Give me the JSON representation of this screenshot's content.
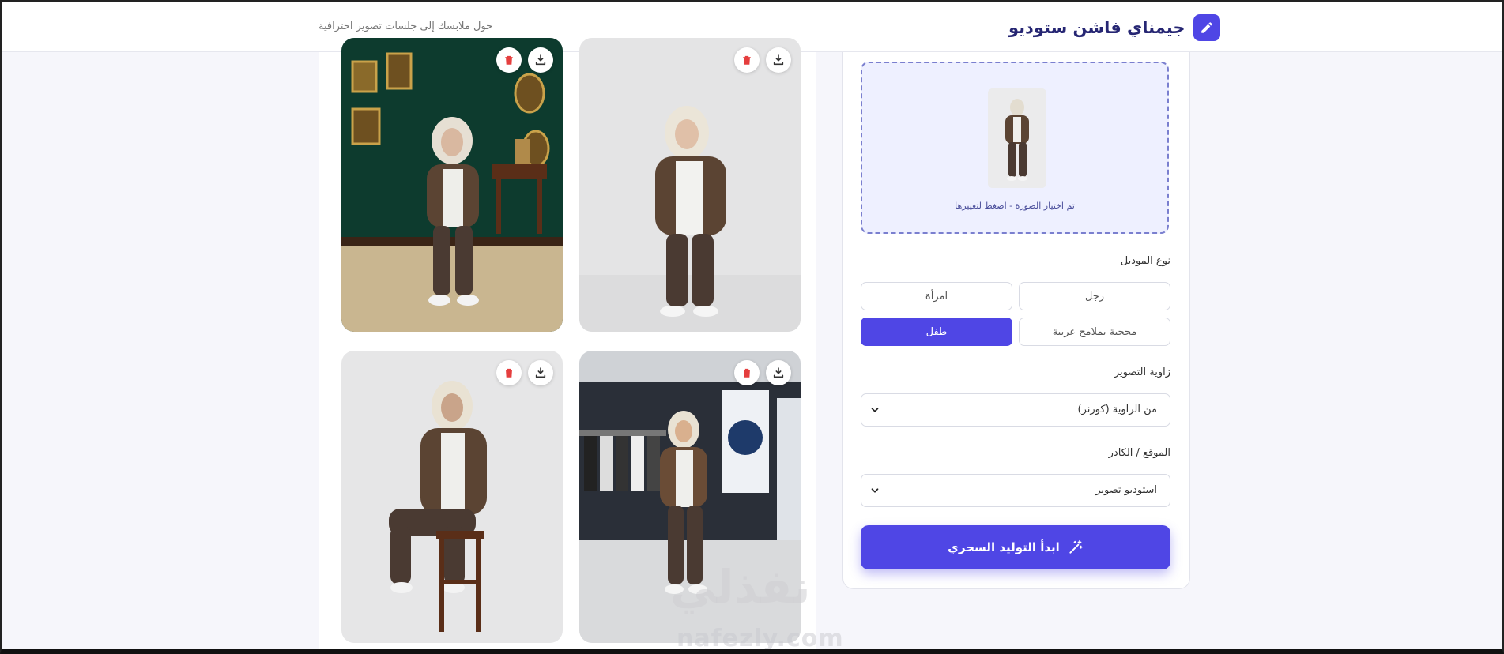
{
  "header": {
    "title": "جيمناي فاشن ستوديو",
    "tagline": "حول ملابسك إلى جلسات تصوير احترافية",
    "logo_icon": "pencil-icon"
  },
  "gallery": {
    "cards": [
      {
        "scene": "classic-room-green-walls",
        "actions": [
          "download-icon",
          "trash-icon"
        ]
      },
      {
        "scene": "plain-studio-grey",
        "actions": [
          "download-icon",
          "trash-icon"
        ]
      },
      {
        "scene": "studio-stool-sitting",
        "actions": [
          "download-icon",
          "trash-icon"
        ]
      },
      {
        "scene": "shopping-mall-store",
        "actions": [
          "download-icon",
          "trash-icon"
        ]
      }
    ]
  },
  "upload": {
    "caption": "تم اختيار الصورة - اضغط لتغييرها"
  },
  "model_type": {
    "label": "نوع الموديل",
    "options": [
      "رجل",
      "امرأة",
      "محجبة بملامح عربية",
      "طفل"
    ],
    "selected": "طفل"
  },
  "angle": {
    "label": "زاوية التصوير",
    "value": "من الزاوية (كورنر)"
  },
  "location": {
    "label": "الموقع / الكادر",
    "value": "استوديو تصوير"
  },
  "generate": {
    "label": "ابدأ التوليد السحري",
    "icon": "magic-wand-icon"
  },
  "watermark": {
    "arabic": "نفذلي",
    "latin": "nafezly.com"
  },
  "colors": {
    "accent": "#4f46e5",
    "title": "#262673"
  }
}
